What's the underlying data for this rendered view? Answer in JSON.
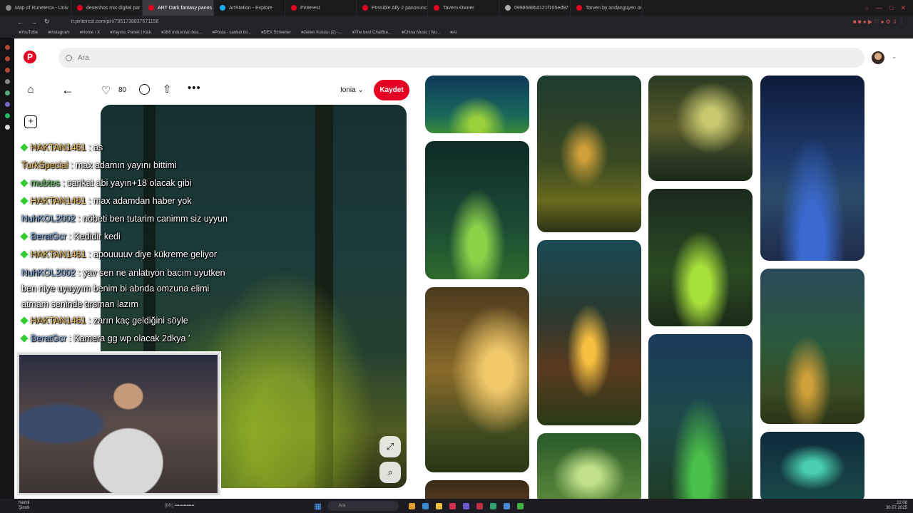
{
  "browser": {
    "tabs": [
      {
        "label": "Map of Runeterra - Univ",
        "color": "#888"
      },
      {
        "label": "desenhos mix digital par",
        "color": "#e60023"
      },
      {
        "label": "ART Dark fantasy panos",
        "color": "#e60023",
        "active": true
      },
      {
        "label": "ArtStation - Explore",
        "color": "#13aff0"
      },
      {
        "label": "Pinterest",
        "color": "#e60023"
      },
      {
        "label": "Possible Ally 2 panosunc",
        "color": "#e60023"
      },
      {
        "label": "Tavern Owner",
        "color": "#e60023"
      },
      {
        "label": "0998588b4121f105ed97",
        "color": "#aaa"
      },
      {
        "label": "Tarven by andanguyen on",
        "color": "#e60023"
      }
    ],
    "url": "tr.pinterest.com/pin/795173883767115​8",
    "bookmarks": [
      "YouTube",
      "Instagram",
      "Home / X",
      "Yayıncı Paneli | Kick",
      "388 Industrial desi...",
      "Posta - cankat bil...",
      "DEX Screener",
      "Gelen Kutusu (2) -...",
      "The best ChatBot...",
      "China Music | No...",
      "Ai"
    ]
  },
  "pinterest": {
    "logo": "P",
    "search_placeholder": "Ara",
    "like_count": "80",
    "board_name": "Ionia",
    "save_label": "Kaydet",
    "help_label": "?"
  },
  "chat": [
    {
      "user": "HAKTAN1461",
      "text": ": as",
      "badge": true,
      "style": "gold"
    },
    {
      "user": "TurkSpecial",
      "text": ": max adamın yayını bittimi",
      "badge": false,
      "style": "gold"
    },
    {
      "user": "mubtes",
      "text": ": cankat abi yayın+18 olacak gibi",
      "badge": true,
      "style": "green"
    },
    {
      "user": "HAKTAN1461",
      "text": ": max adamdan haber yok",
      "badge": true,
      "style": "gold"
    },
    {
      "user": "NuhKOL2002",
      "text": ": nöbeti ben tutarim canimm siz uyyun",
      "badge": false,
      "style": "mod"
    },
    {
      "user": "BeratGcr",
      "text": ": Kedidir kedi",
      "badge": true,
      "style": "mod"
    },
    {
      "user": "HAKTAN1461",
      "text": ": apouuuuv diye kükreme geliyor",
      "badge": true,
      "style": "gold"
    },
    {
      "user": "NuhKOL2002",
      "text": ": yav sen ne anlatıyon bacım uyutken ben niye uyuyyım benim bi abnda omzuna elimi atmam seninde tırsman lazım",
      "badge": false,
      "style": "mod",
      "wrap": true
    },
    {
      "user": "HAKTAN1461",
      "text": ": zarın kaç geldiğini söyle",
      "badge": true,
      "style": "gold"
    },
    {
      "user": "BeratGcr",
      "text": ": Kamera gg wp olacak 2dkya '",
      "badge": true,
      "style": "mod"
    }
  ],
  "taskbar": {
    "weather_line1": "Nemli",
    "weather_line2": "Şimdi",
    "media": "[00:] ▪▪▪▪▪▪▪▪▪▪▪▪▪",
    "search": "Ara",
    "time": "22:08",
    "date": "30.07.2025"
  }
}
